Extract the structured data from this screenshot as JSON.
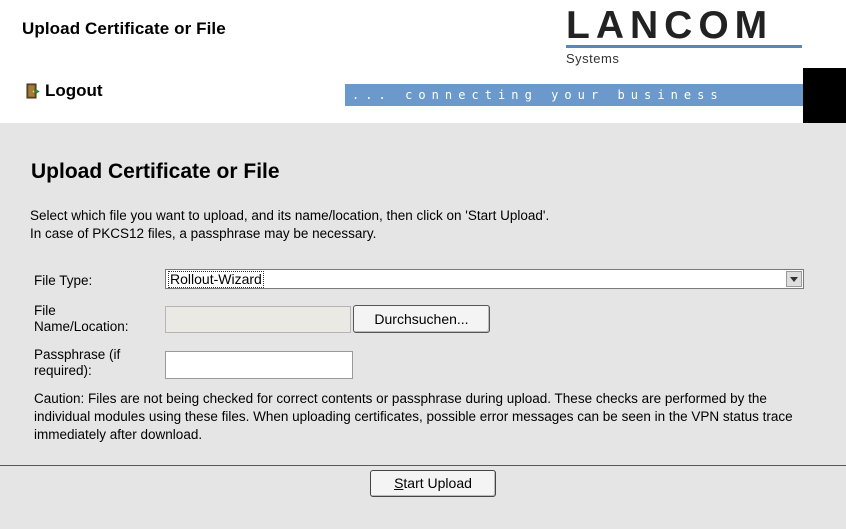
{
  "header": {
    "title": "Upload Certificate or File",
    "logout_label": "Logout",
    "slogan": "... connecting your business"
  },
  "logo": {
    "name": "LANCOM",
    "sub": "Systems"
  },
  "main": {
    "heading": "Upload Certificate or File",
    "description_line1": "Select which file you want to upload, and its name/location, then click on 'Start Upload'.",
    "description_line2": "In case of PKCS12 files, a passphrase may be necessary.",
    "file_type_label": "File Type:",
    "file_type_value": "Rollout-Wizard",
    "file_name_label_line1": "File",
    "file_name_label_line2": "Name/Location:",
    "file_name_value": "",
    "browse_label": "Durchsuchen...",
    "passphrase_label_line1": "Passphrase (if",
    "passphrase_label_line2": "required):",
    "passphrase_value": "",
    "caution": "Caution: Files are not being checked for correct contents or passphrase during upload. These checks are performed by the individual modules using these files. When uploading certificates, possible error messages can be seen in the VPN status trace immediately after download.",
    "start_upload_mnemonic": "S",
    "start_upload_rest": "tart Upload"
  },
  "colors": {
    "slogan_bar": "#6b99cb",
    "content_bg": "#e5e5e5",
    "logo_bar": "#5b86ba"
  }
}
